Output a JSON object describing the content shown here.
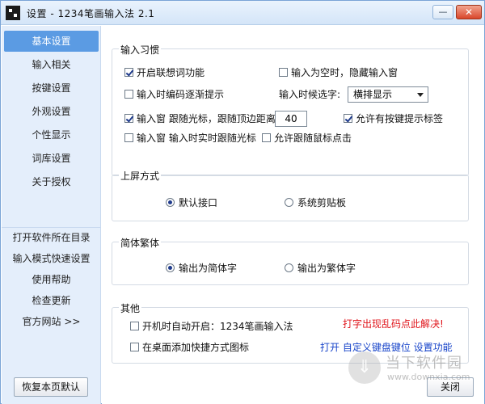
{
  "window": {
    "title": "设置 - 1234笔画输入法 2.1",
    "minimize_glyph": "—",
    "close_glyph": "✕"
  },
  "sidebar": {
    "items": [
      {
        "label": "基本设置",
        "active": true
      },
      {
        "label": "输入相关",
        "active": false
      },
      {
        "label": "按键设置",
        "active": false
      },
      {
        "label": "外观设置",
        "active": false
      },
      {
        "label": "个性显示",
        "active": false
      },
      {
        "label": "词库设置",
        "active": false
      },
      {
        "label": "关于授权",
        "active": false
      }
    ],
    "links": [
      {
        "label": "打开软件所在目录"
      },
      {
        "label": "输入模式快速设置"
      },
      {
        "label": "使用帮助"
      },
      {
        "label": "检查更新"
      },
      {
        "label": "官方网站 >>"
      }
    ],
    "reset_button": "恢复本页默认"
  },
  "input_habits": {
    "title": "输入习惯",
    "enable_association": {
      "label": "开启联想词功能",
      "checked": true
    },
    "hide_when_empty": {
      "label": "输入为空时，隐藏输入窗",
      "checked": false
    },
    "gradual_hint": {
      "label": "输入时编码逐渐提示",
      "checked": false
    },
    "candidate_label": "输入时候选字:",
    "candidate_value": "横排显示",
    "follow_cursor": {
      "label": "输入窗 跟随光标，跟随顶边距离:",
      "checked": true
    },
    "top_distance": "40",
    "allow_key_hint": {
      "label": "允许有按键提示标签",
      "checked": true
    },
    "realtime_follow": {
      "label": "输入窗 输入时实时跟随光标",
      "checked": false
    },
    "follow_mouse": {
      "label": "允许跟随鼠标点击",
      "checked": false
    }
  },
  "commit_mode": {
    "title": "上屏方式",
    "default_interface": {
      "label": "默认接口",
      "checked": true
    },
    "clipboard": {
      "label": "系统剪贴板",
      "checked": false
    }
  },
  "script_mode": {
    "title": "简体繁体",
    "simplified": {
      "label": "输出为简体字",
      "checked": true
    },
    "traditional": {
      "label": "输出为繁体字",
      "checked": false
    }
  },
  "other": {
    "title": "其他",
    "autostart": {
      "label": "开机时自动开启：1234笔画输入法",
      "checked": false
    },
    "desktop_shortcut": {
      "label": "在桌面添加快捷方式图标",
      "checked": false
    },
    "garbled_fix": "打字出现乱码点此解决!",
    "custom_keys": "打开 自定义键盘键位 设置功能"
  },
  "footer": {
    "close_button": "关闭"
  },
  "watermark": {
    "title": "当下软件园",
    "url": "www.downxia.com",
    "logo_icon": "down-arrow-logo-icon"
  },
  "colors": {
    "sidebar_bg": "#e4eefb",
    "active_nav": "#5b9be3",
    "red_link": "#e0151b",
    "blue_link": "#1643c9"
  }
}
